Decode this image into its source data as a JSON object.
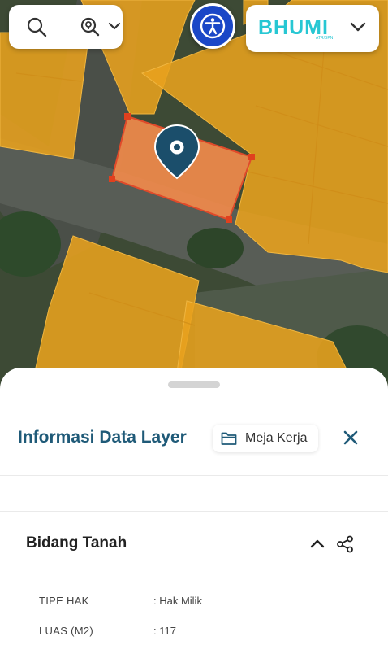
{
  "header": {
    "brand_name": "BHUMI",
    "brand_tagline": "ATR/BPN"
  },
  "colors": {
    "parcel_fill": "#e8a21e",
    "selected_parcel": "#f08a4b",
    "pin": "#1b4e6b",
    "accessibility_button": "#1a47c7",
    "brand": "#27c7d3",
    "title": "#1f5a78"
  },
  "icons": {
    "search": "search-icon",
    "geo_search": "location-search-icon",
    "accessibility": "accessibility-icon",
    "brand_menu": "chevron-down-icon",
    "workspace": "folder-icon",
    "close": "close-icon",
    "collapse": "chevron-up-icon",
    "share": "share-icon",
    "marker": "map-pin-icon"
  },
  "sheet": {
    "title": "Informasi Data Layer",
    "workspace_label": "Meja Kerja"
  },
  "section": {
    "title": "Bidang Tanah",
    "attributes": [
      {
        "key": "TIPE HAK",
        "value": ": Hak Milik"
      },
      {
        "key": "LUAS (M2)",
        "value": ": 117"
      }
    ]
  }
}
